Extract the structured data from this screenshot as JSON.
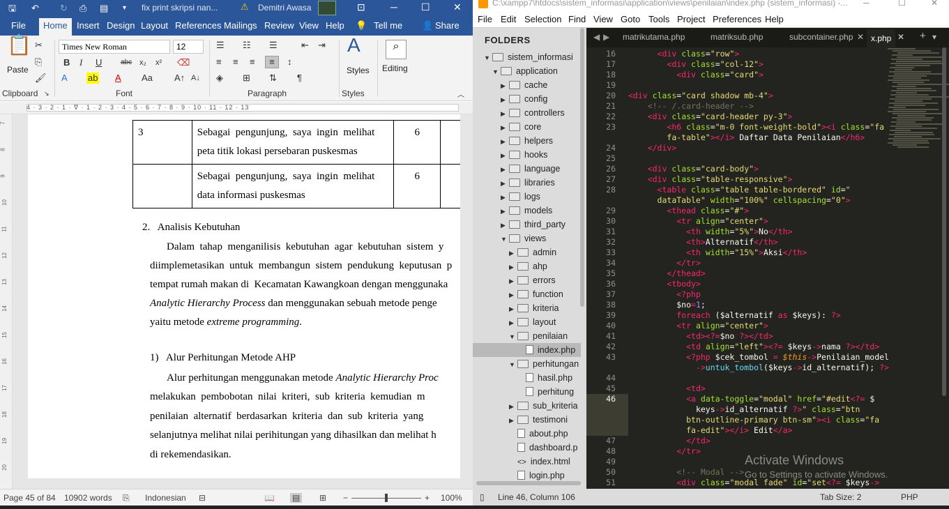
{
  "word": {
    "title": {
      "doc_title": "fix print skripsi nan...",
      "warning_icon": "warning-icon",
      "user": "Demitri Awasa"
    },
    "tabs": [
      "File",
      "Home",
      "Insert",
      "Design",
      "Layout",
      "References",
      "Mailings",
      "Review",
      "View",
      "Help",
      "Tell me",
      "Share"
    ],
    "ribbon": {
      "paste": "Paste",
      "clipboard": "Clipboard",
      "font_name": "Times New Roman",
      "font_size": "12",
      "font": "Font",
      "paragraph": "Paragraph",
      "styles_btn": "Styles",
      "styles": "Styles",
      "editing": "Editing"
    },
    "ruler_numbers": "4 · 3 · 2 · 1 · ∇ · 1 · 2 · 3 · 4 · 5 · 6 · 7 · 8 · 9 · 10 · 11 · 12 · 13",
    "vruler": [
      "7",
      "8",
      "9",
      "10",
      "11",
      "12",
      "13",
      "14",
      "15",
      "16",
      "17",
      "18",
      "19",
      "20"
    ],
    "table_rows": [
      {
        "no": "3",
        "text1": "Sebagai  pengunjung,  saya  ingin  melihat",
        "text2": "peta titik lokasi persebaran puskesmas",
        "val": "6"
      },
      {
        "no": "",
        "text1": "Sebagai  pengunjung,  saya  ingin  melihat",
        "text2": "data informasi puskesmas",
        "val": "6"
      }
    ],
    "heading2": "2.   Analisis Kebutuhan",
    "p1": [
      "Dalam  tahap  menganilisis  kebutuhan  agar  kebutuhan  sistem  y",
      "diimplemetasikan  untuk  membangun  sistem  pendukung  keputusan  p",
      "tempat rumah makan di  Kecamatan Kawangkoan dengan menggunaka"
    ],
    "p1_line4_italic": "Analytic Hierarchy Process",
    "p1_line4_rest": " dan menggunakan sebuah metode penge",
    "p1_line5_pre": "yaitu metode ",
    "p1_line5_italic": "extreme programming",
    "p1_line5_post": ".",
    "heading3": "1)   Alur Perhitungan Metode AHP",
    "p2_line1_pre": "Alur perhitungan menggunakan metode ",
    "p2_line1_italic": "Analytic Hierarchy Proc",
    "p2": [
      "melakukan  pembobotan  nilai  kriteri,  sub  kriteria  kemudian  m",
      "penilaian  alternatif  berdasarkan  kriteria  dan  sub  kriteria  yang",
      "selanjutnya melihat nilai perihitungan yang dihasilkan dan melihat h",
      "di rekemendasikan."
    ],
    "status": {
      "page": "Page 45 of 84",
      "words": "10902 words",
      "language": "Indonesian",
      "zoom": "100%"
    }
  },
  "sublime": {
    "title": "C:\\xampp7\\htdocs\\sistem_informasi\\application\\views\\penilaian\\index.php (sistem_informasi) -...",
    "menu": [
      "File",
      "Edit",
      "Selection",
      "Find",
      "View",
      "Goto",
      "Tools",
      "Project",
      "Preferences",
      "Help"
    ],
    "folders_label": "FOLDERS",
    "tree": [
      {
        "label": "sistem_informasi",
        "type": "folder",
        "open": true
      },
      {
        "label": "application",
        "type": "folder",
        "open": true
      },
      {
        "label": "cache",
        "type": "folder"
      },
      {
        "label": "config",
        "type": "folder"
      },
      {
        "label": "controllers",
        "type": "folder"
      },
      {
        "label": "core",
        "type": "folder"
      },
      {
        "label": "helpers",
        "type": "folder"
      },
      {
        "label": "hooks",
        "type": "folder"
      },
      {
        "label": "language",
        "type": "folder"
      },
      {
        "label": "libraries",
        "type": "folder"
      },
      {
        "label": "logs",
        "type": "folder"
      },
      {
        "label": "models",
        "type": "folder"
      },
      {
        "label": "third_party",
        "type": "folder"
      },
      {
        "label": "views",
        "type": "folder",
        "open": true
      },
      {
        "label": "admin",
        "type": "folder"
      },
      {
        "label": "ahp",
        "type": "folder"
      },
      {
        "label": "errors",
        "type": "folder"
      },
      {
        "label": "function",
        "type": "folder"
      },
      {
        "label": "kriteria",
        "type": "folder"
      },
      {
        "label": "layout",
        "type": "folder"
      },
      {
        "label": "penilaian",
        "type": "folder",
        "open": true
      },
      {
        "label": "index.php",
        "type": "file"
      },
      {
        "label": "perhitungan",
        "type": "folder",
        "open": true
      },
      {
        "label": "hasil.php",
        "type": "file"
      },
      {
        "label": "perhitung",
        "type": "file"
      },
      {
        "label": "sub_kriteria",
        "type": "folder"
      },
      {
        "label": "testimoni",
        "type": "folder"
      },
      {
        "label": "about.php",
        "type": "file"
      },
      {
        "label": "dashboard.p",
        "type": "file"
      },
      {
        "label": "index.html",
        "type": "code"
      },
      {
        "label": "login.php",
        "type": "file"
      }
    ],
    "tabs": [
      "matrikutama.php",
      "matriksub.php",
      "subcontainer.php",
      "x.php"
    ],
    "lines": [
      {
        "n": "16",
        "html": "      <span class=\"k\">&lt;div</span> <span class=\"a\">class</span>=<span class=\"s\">\"row\"</span><span class=\"k\">&gt;</span>"
      },
      {
        "n": "17",
        "html": "        <span class=\"k\">&lt;div</span> <span class=\"a\">class</span>=<span class=\"s\">\"col-12\"</span><span class=\"k\">&gt;</span>"
      },
      {
        "n": "18",
        "html": "          <span class=\"k\">&lt;div</span> <span class=\"a\">class</span>=<span class=\"s\">\"card\"</span><span class=\"k\">&gt;</span>"
      },
      {
        "n": "19",
        "html": ""
      },
      {
        "n": "20",
        "html": "<span class=\"k\">&lt;div</span> <span class=\"a\">class</span>=<span class=\"s\">\"card shadow mb-4\"</span><span class=\"k\">&gt;</span>"
      },
      {
        "n": "21",
        "html": "    <span class=\"c\">&lt;!-- /.card-header --&gt;</span>"
      },
      {
        "n": "22",
        "html": "    <span class=\"k\">&lt;div</span> <span class=\"a\">class</span>=<span class=\"s\">\"card-header py-3\"</span><span class=\"k\">&gt;</span>"
      },
      {
        "n": "23",
        "html": "        <span class=\"k\">&lt;h6</span> <span class=\"a\">class</span>=<span class=\"s\">\"m-0 font-weight-bold\"</span><span class=\"k\">&gt;&lt;i</span> <span class=\"a\">class</span>=<span class=\"s\">\"fa</span>"
      },
      {
        "n": "",
        "html": "        <span class=\"s\">fa-table\"</span><span class=\"k\">&gt;&lt;/i&gt;</span> Daftar Data Penilaian<span class=\"k\">&lt;/h6&gt;</span>"
      },
      {
        "n": "24",
        "html": "    <span class=\"k\">&lt;/div&gt;</span>"
      },
      {
        "n": "25",
        "html": ""
      },
      {
        "n": "26",
        "html": "    <span class=\"k\">&lt;div</span> <span class=\"a\">class</span>=<span class=\"s\">\"card-body\"</span><span class=\"k\">&gt;</span>"
      },
      {
        "n": "27",
        "html": "    <span class=\"k\">&lt;div</span> <span class=\"a\">class</span>=<span class=\"s\">\"table-responsive\"</span><span class=\"k\">&gt;</span>"
      },
      {
        "n": "28",
        "html": "      <span class=\"k\">&lt;table</span> <span class=\"a\">class</span>=<span class=\"s\">\"table table-bordered\"</span> <span class=\"a\">id</span>=<span class=\"s\">\"</span>"
      },
      {
        "n": "",
        "html": "      <span class=\"s\">dataTable\"</span> <span class=\"a\">width</span>=<span class=\"s\">\"100%\"</span> <span class=\"a\">cellspacing</span>=<span class=\"s\">\"0\"</span><span class=\"k\">&gt;</span>"
      },
      {
        "n": "29",
        "html": "        <span class=\"k\">&lt;thead</span> <span class=\"a\">class</span>=<span class=\"s\">\"#\"</span><span class=\"k\">&gt;</span>"
      },
      {
        "n": "30",
        "html": "          <span class=\"k\">&lt;tr</span> <span class=\"a\">align</span>=<span class=\"s\">\"center\"</span><span class=\"k\">&gt;</span>"
      },
      {
        "n": "31",
        "html": "            <span class=\"k\">&lt;th</span> <span class=\"a\">width</span>=<span class=\"s\">\"5%\"</span><span class=\"k\">&gt;</span>No<span class=\"k\">&lt;/th&gt;</span>"
      },
      {
        "n": "32",
        "html": "            <span class=\"k\">&lt;th&gt;</span>Alternatif<span class=\"k\">&lt;/th&gt;</span>"
      },
      {
        "n": "33",
        "html": "            <span class=\"k\">&lt;th</span> <span class=\"a\">width</span>=<span class=\"s\">\"15%\"</span><span class=\"k\">&gt;</span>Aksi<span class=\"k\">&lt;/th&gt;</span>"
      },
      {
        "n": "34",
        "html": "          <span class=\"k\">&lt;/tr&gt;</span>"
      },
      {
        "n": "35",
        "html": "        <span class=\"k\">&lt;/thead&gt;</span>"
      },
      {
        "n": "36",
        "html": "        <span class=\"k\">&lt;tbody&gt;</span>"
      },
      {
        "n": "37",
        "html": "          <span class=\"k\">&lt;?php</span>"
      },
      {
        "n": "38",
        "html": "          <span class=\"w\">$no</span><span class=\"k\">=</span><span class=\"n\">1</span>;"
      },
      {
        "n": "39",
        "html": "          <span class=\"k\">foreach</span> (<span class=\"w\">$alternatif</span> <span class=\"k\">as</span> <span class=\"w\">$keys</span>): <span class=\"k\">?&gt;</span>"
      },
      {
        "n": "40",
        "html": "          <span class=\"k\">&lt;tr</span> <span class=\"a\">align</span>=<span class=\"s\">\"center\"</span><span class=\"k\">&gt;</span>"
      },
      {
        "n": "41",
        "html": "            <span class=\"k\">&lt;td&gt;&lt;?=</span><span class=\"w\">$no</span> <span class=\"k\">?&gt;&lt;/td&gt;</span>"
      },
      {
        "n": "42",
        "html": "            <span class=\"k\">&lt;td</span> <span class=\"a\">align</span>=<span class=\"s\">\"left\"</span><span class=\"k\">&gt;&lt;?=</span> <span class=\"w\">$keys</span><span class=\"k\">-&gt;</span>nama <span class=\"k\">?&gt;&lt;/td&gt;</span>"
      },
      {
        "n": "43",
        "html": "            <span class=\"k\">&lt;?php</span> <span class=\"w\">$cek_tombol</span> <span class=\"k\">=</span> <span class=\"v\">$this</span><span class=\"k\">-&gt;</span>Penilaian_model"
      },
      {
        "n": "",
        "html": "              <span class=\"k\">-&gt;</span><span class=\"b\">untuk_tombol</span>(<span class=\"w\">$keys</span><span class=\"k\">-&gt;</span>id_alternatif); <span class=\"k\">?&gt;</span>"
      },
      {
        "n": "44",
        "html": ""
      },
      {
        "n": "45",
        "html": "            <span class=\"k\">&lt;td&gt;</span>"
      },
      {
        "n": "46",
        "html": "            <span class=\"k\">&lt;a</span> <span class=\"a\">data-toggle</span>=<span class=\"s\">\"modal\"</span> <span class=\"a\">href</span>=<span class=\"s\">\"#edit</span><span class=\"k\">&lt;?=</span> <span class=\"w\">$</span>"
      },
      {
        "n": "",
        "html": "              <span class=\"w\">keys</span><span class=\"k\">-&gt;</span>id_alternatif <span class=\"k\">?&gt;</span><span class=\"s\">\"</span> <span class=\"a\">class</span>=<span class=\"s\">\"btn</span>"
      },
      {
        "n": "",
        "html": "            <span class=\"s\">btn-outline-primary btn-sm\"</span><span class=\"k\">&gt;&lt;i</span> <span class=\"a\">class</span>=<span class=\"s\">\"fa</span>"
      },
      {
        "n": "",
        "html": "            <span class=\"s\">fa-edit\"</span><span class=\"k\">&gt;&lt;/i&gt;</span> Edit<span class=\"k\">&lt;/a&gt;</span>"
      },
      {
        "n": "47",
        "html": "            <span class=\"k\">&lt;/td&gt;</span>"
      },
      {
        "n": "48",
        "html": "          <span class=\"k\">&lt;/tr&gt;</span>"
      },
      {
        "n": "49",
        "html": ""
      },
      {
        "n": "50",
        "html": "          <span class=\"c\">&lt;!-- Modal --&gt;</span>"
      },
      {
        "n": "51",
        "html": "          <span class=\"k\">&lt;div</span> <span class=\"a\">class</span>=<span class=\"s\">\"modal fade\"</span> <span class=\"a\">id</span>=<span class=\"s\">\"set</span><span class=\"k\">&lt;?=</span> <span class=\"w\">$keys</span><span class=\"k\">-&gt;</span>"
      }
    ],
    "watermark_title": "Activate Windows",
    "watermark_sub": "Go to Settings to activate Windows.",
    "status": {
      "position": "Line 46, Column 106",
      "tab_size": "Tab Size: 2",
      "syntax": "PHP"
    }
  }
}
